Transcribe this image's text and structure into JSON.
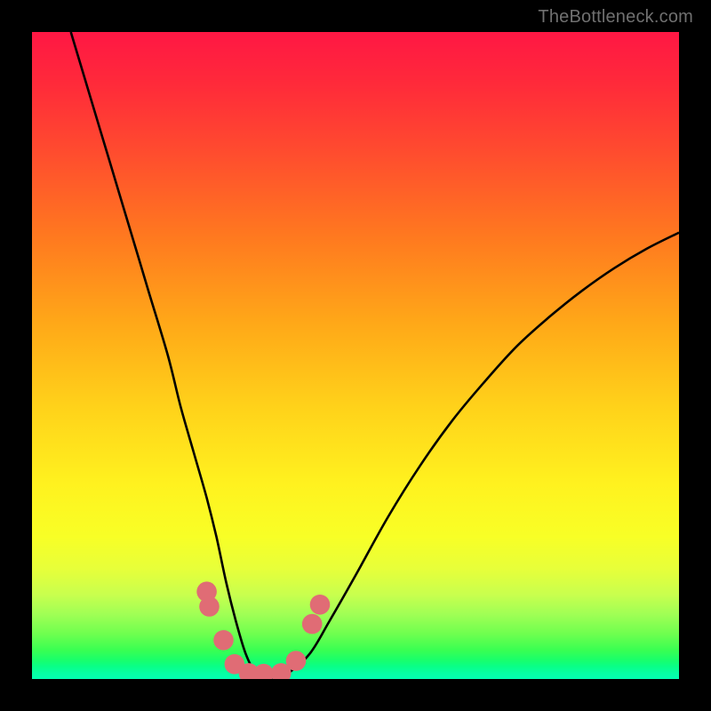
{
  "watermark": "TheBottleneck.com",
  "chart_data": {
    "type": "line",
    "title": "",
    "xlabel": "",
    "ylabel": "",
    "xlim": [
      0,
      100
    ],
    "ylim": [
      0,
      100
    ],
    "series": [
      {
        "name": "curve",
        "x": [
          6,
          9,
          12,
          15,
          18,
          21,
          23,
          25,
          27,
          28.5,
          30,
          31.5,
          33,
          34.5,
          36,
          38,
          40,
          43,
          46,
          50,
          55,
          60,
          65,
          70,
          75,
          80,
          85,
          90,
          95,
          100
        ],
        "y": [
          100,
          90,
          80,
          70,
          60,
          50,
          42,
          35,
          28,
          22,
          15,
          9,
          4,
          1,
          0,
          0,
          1.2,
          4,
          9,
          16,
          25,
          33,
          40,
          46,
          51.5,
          56,
          60,
          63.5,
          66.5,
          69
        ]
      }
    ],
    "markers": [
      {
        "x": 27.0,
        "y": 13.5,
        "r": 1.55
      },
      {
        "x": 27.4,
        "y": 11.2,
        "r": 1.55
      },
      {
        "x": 29.6,
        "y": 6.0,
        "r": 1.55
      },
      {
        "x": 31.3,
        "y": 2.3,
        "r": 1.55
      },
      {
        "x": 33.5,
        "y": 0.9,
        "r": 1.55
      },
      {
        "x": 35.8,
        "y": 0.8,
        "r": 1.55
      },
      {
        "x": 38.5,
        "y": 0.9,
        "r": 1.55
      },
      {
        "x": 40.8,
        "y": 2.8,
        "r": 1.55
      },
      {
        "x": 43.3,
        "y": 8.5,
        "r": 1.55
      },
      {
        "x": 44.5,
        "y": 11.5,
        "r": 1.55
      }
    ],
    "marker_color": "#e06c75",
    "curve_color": "#000000",
    "curve_width": 2.6
  }
}
